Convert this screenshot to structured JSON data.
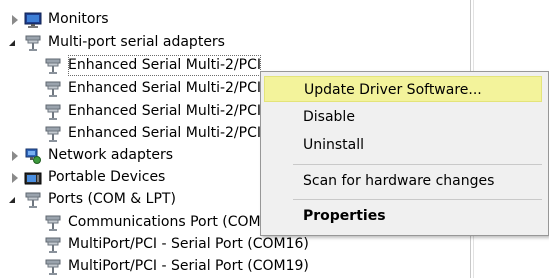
{
  "tree": {
    "items": [
      {
        "label": "Monitors",
        "state": "collapsed",
        "icon": "monitor-icon"
      },
      {
        "label": "Multi-port serial adapters",
        "state": "expanded",
        "icon": "serial-port-icon"
      },
      {
        "label": "Enhanced Serial Multi-2/PCI",
        "state": "leaf",
        "icon": "serial-port-icon"
      },
      {
        "label": "Enhanced Serial Multi-2/PCI",
        "state": "leaf",
        "icon": "serial-port-icon"
      },
      {
        "label": "Enhanced Serial Multi-2/PCI",
        "state": "leaf",
        "icon": "serial-port-icon"
      },
      {
        "label": "Enhanced Serial Multi-2/PCI",
        "state": "leaf",
        "icon": "serial-port-icon"
      },
      {
        "label": "Network adapters",
        "state": "collapsed",
        "icon": "network-adapter-icon"
      },
      {
        "label": "Portable Devices",
        "state": "collapsed",
        "icon": "portable-device-icon"
      },
      {
        "label": "Ports (COM & LPT)",
        "state": "expanded",
        "icon": "serial-port-icon"
      },
      {
        "label": "Communications Port (COM",
        "state": "leaf",
        "icon": "serial-port-icon"
      },
      {
        "label": "MultiPort/PCI - Serial Port (COM16)",
        "state": "leaf",
        "icon": "serial-port-icon"
      },
      {
        "label": "MultiPort/PCI - Serial Port (COM19)",
        "state": "leaf",
        "icon": "serial-port-icon"
      }
    ]
  },
  "context_menu": {
    "items": [
      {
        "label": "Update Driver Software...",
        "highlighted": true
      },
      {
        "label": "Disable"
      },
      {
        "label": "Uninstall"
      },
      {
        "label": "Scan for hardware changes"
      },
      {
        "label": "Properties",
        "bold": true
      }
    ],
    "highlight_color": "#f3f39b"
  }
}
